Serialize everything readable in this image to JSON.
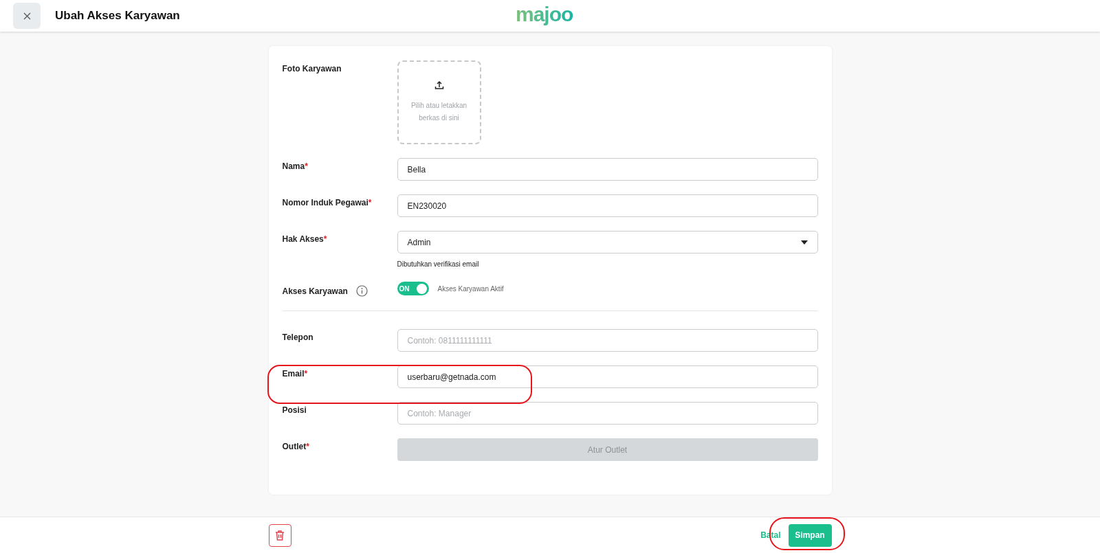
{
  "header": {
    "title": "Ubah Akses Karyawan",
    "logo": "majoo"
  },
  "form": {
    "fields": [
      {
        "kind": "upload",
        "label": "Foto Karyawan",
        "hint": "Pilih atau letakkan berkas di sini"
      },
      {
        "kind": "text",
        "label": "Nama",
        "required_mark": "*",
        "value": "Bella"
      },
      {
        "kind": "text",
        "label": "Nomor Induk Pegawai",
        "required_mark": "*",
        "value": "EN230020"
      },
      {
        "kind": "select",
        "label": "Hak Akses",
        "required_mark": "*",
        "value": "Admin",
        "helper": "Dibutuhkan verifikasi email"
      },
      {
        "kind": "toggle",
        "label": "Akses Karyawan",
        "on": true,
        "switch_text": "ON",
        "caption": "Akses Karyawan Aktif"
      },
      {
        "kind": "divider"
      },
      {
        "kind": "text",
        "label": "Telepon",
        "placeholder": "Contoh: 0811111111111"
      },
      {
        "kind": "text",
        "label": "Email",
        "required_mark": "*",
        "value": "userbaru@getnada.com"
      },
      {
        "kind": "text",
        "label": "Posisi",
        "placeholder": "Contoh: Manager"
      },
      {
        "kind": "button",
        "label": "Outlet",
        "required_mark": "*",
        "button": "Atur Outlet",
        "disabled": true
      }
    ]
  },
  "footer": {
    "cancel": "Batal",
    "save": "Simpan"
  }
}
